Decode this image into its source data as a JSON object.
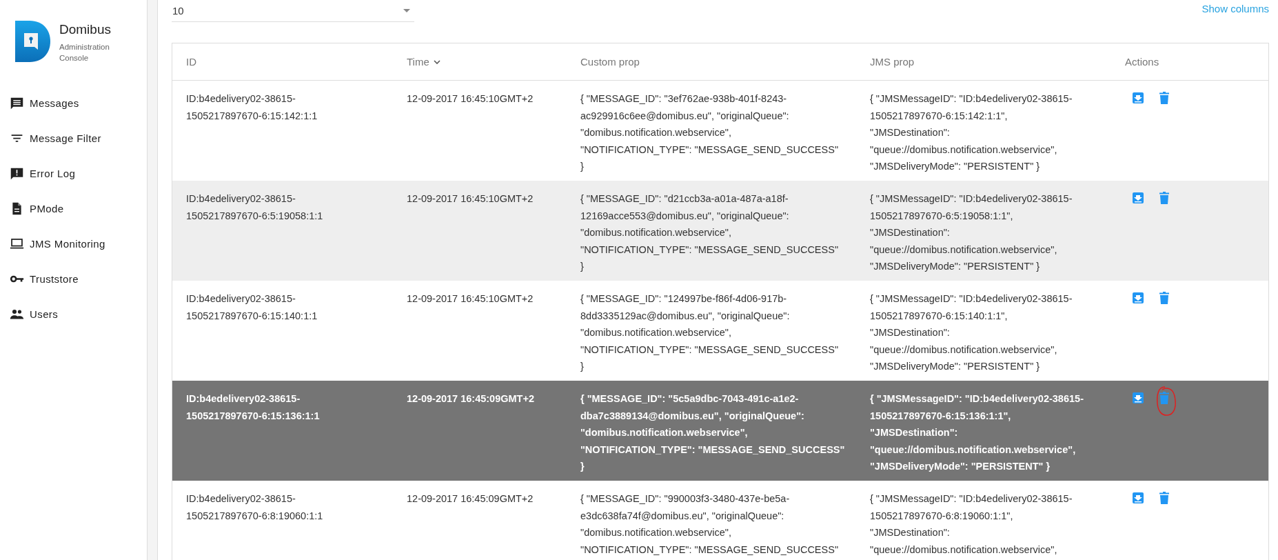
{
  "brand": {
    "name": "Domibus",
    "subtitle": "Administration\nConsole"
  },
  "sidebar": {
    "items": [
      {
        "label": "Messages",
        "kind": "message"
      },
      {
        "label": "Message Filter",
        "kind": "filter"
      },
      {
        "label": "Error Log",
        "kind": "error"
      },
      {
        "label": "PMode",
        "kind": "file"
      },
      {
        "label": "JMS Monitoring",
        "kind": "laptop"
      },
      {
        "label": "Truststore",
        "kind": "key"
      },
      {
        "label": "Users",
        "kind": "users"
      }
    ]
  },
  "page_size": {
    "value": "10"
  },
  "show_columns": "Show columns",
  "table": {
    "columns": [
      {
        "label": "ID",
        "sorted": false
      },
      {
        "label": "Time",
        "sorted": true
      },
      {
        "label": "Custom prop",
        "sorted": false
      },
      {
        "label": "JMS prop",
        "sorted": false
      },
      {
        "label": "Actions",
        "sorted": false
      }
    ],
    "rows": [
      {
        "selected": false,
        "marked": false,
        "id": "ID:b4edelivery02-38615-\n1505217897670-6:15:142:1:1",
        "time": "12-09-2017 16:45:10GMT+2",
        "custom": "{ \"MESSAGE_ID\": \"3ef762ae-938b-401f-8243-\nac929916c6ee@domibus.eu\", \"originalQueue\":\n\"domibus.notification.webservice\",\n\"NOTIFICATION_TYPE\": \"MESSAGE_SEND_SUCCESS\"\n}",
        "jms": "{ \"JMSMessageID\": \"ID:b4edelivery02-38615-\n1505217897670-6:15:142:1:1\",\n\"JMSDestination\":\n\"queue://domibus.notification.webservice\",\n\"JMSDeliveryMode\": \"PERSISTENT\" }"
      },
      {
        "selected": false,
        "marked": false,
        "id": "ID:b4edelivery02-38615-\n1505217897670-6:5:19058:1:1",
        "time": "12-09-2017 16:45:10GMT+2",
        "custom": "{ \"MESSAGE_ID\": \"d21ccb3a-a01a-487a-a18f-\n12169acce553@domibus.eu\", \"originalQueue\":\n\"domibus.notification.webservice\",\n\"NOTIFICATION_TYPE\": \"MESSAGE_SEND_SUCCESS\"\n}",
        "jms": "{ \"JMSMessageID\": \"ID:b4edelivery02-38615-\n1505217897670-6:5:19058:1:1\",\n\"JMSDestination\":\n\"queue://domibus.notification.webservice\",\n\"JMSDeliveryMode\": \"PERSISTENT\" }"
      },
      {
        "selected": false,
        "marked": false,
        "id": "ID:b4edelivery02-38615-\n1505217897670-6:15:140:1:1",
        "time": "12-09-2017 16:45:10GMT+2",
        "custom": "{ \"MESSAGE_ID\": \"124997be-f86f-4d06-917b-\n8dd3335129ac@domibus.eu\", \"originalQueue\":\n\"domibus.notification.webservice\",\n\"NOTIFICATION_TYPE\": \"MESSAGE_SEND_SUCCESS\"\n}",
        "jms": "{ \"JMSMessageID\": \"ID:b4edelivery02-38615-\n1505217897670-6:15:140:1:1\",\n\"JMSDestination\":\n\"queue://domibus.notification.webservice\",\n\"JMSDeliveryMode\": \"PERSISTENT\" }"
      },
      {
        "selected": true,
        "marked": true,
        "id": "ID:b4edelivery02-38615-\n1505217897670-6:15:136:1:1",
        "time": "12-09-2017 16:45:09GMT+2",
        "custom": "{ \"MESSAGE_ID\": \"5c5a9dbc-7043-491c-a1e2-\ndba7c3889134@domibus.eu\", \"originalQueue\":\n\"domibus.notification.webservice\",\n\"NOTIFICATION_TYPE\": \"MESSAGE_SEND_SUCCESS\"\n}",
        "jms": "{ \"JMSMessageID\": \"ID:b4edelivery02-38615-\n1505217897670-6:15:136:1:1\",\n\"JMSDestination\":\n\"queue://domibus.notification.webservice\",\n\"JMSDeliveryMode\": \"PERSISTENT\" }"
      },
      {
        "selected": false,
        "marked": false,
        "id": "ID:b4edelivery02-38615-\n1505217897670-6:8:19060:1:1",
        "time": "12-09-2017 16:45:09GMT+2",
        "custom": "{ \"MESSAGE_ID\": \"990003f3-3480-437e-be5a-\ne3dc638fa74f@domibus.eu\", \"originalQueue\":\n\"domibus.notification.webservice\",\n\"NOTIFICATION_TYPE\": \"MESSAGE_SEND_SUCCESS\"",
        "jms": "{ \"JMSMessageID\": \"ID:b4edelivery02-38615-\n1505217897670-6:8:19060:1:1\",\n\"JMSDestination\":\n\"queue://domibus.notification.webservice\","
      }
    ]
  }
}
